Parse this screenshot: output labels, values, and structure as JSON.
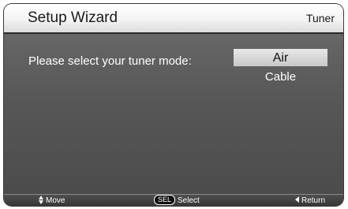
{
  "header": {
    "title": "Setup Wizard",
    "section": "Tuner"
  },
  "main": {
    "prompt": "Please select your tuner mode:",
    "options": [
      {
        "label": "Air",
        "selected": true
      },
      {
        "label": "Cable",
        "selected": false
      }
    ]
  },
  "footer": {
    "move": {
      "icon": "up-down-arrows-icon",
      "label": "Move"
    },
    "select": {
      "key": "SEL",
      "label": "Select"
    },
    "return": {
      "icon": "left-arrow-icon",
      "label": "Return"
    }
  },
  "colors": {
    "panel": "#585858",
    "titlebar": "#ffffff",
    "highlight": "#d8d8d8",
    "text": "#ffffff"
  }
}
